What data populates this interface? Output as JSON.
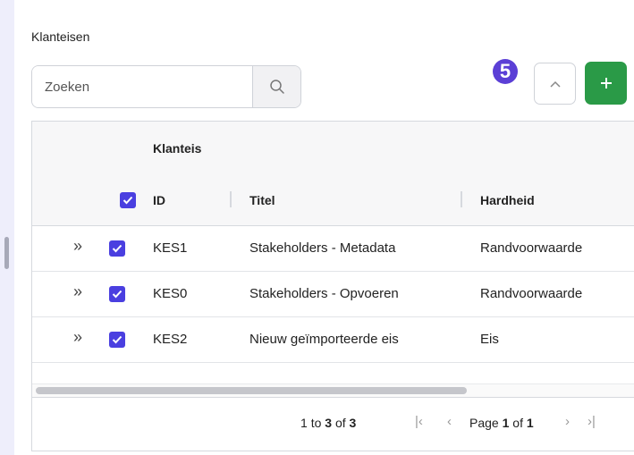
{
  "section": {
    "title": "Klanteisen"
  },
  "search": {
    "placeholder": "Zoeken"
  },
  "step_badge": "5",
  "colors": {
    "accent": "#5b3fd6",
    "add_button": "#2a9a47",
    "checkbox": "#4a3fe0"
  },
  "toolbar": {
    "collapse_icon": "chevron-up-icon",
    "add_icon": "plus-icon"
  },
  "table": {
    "group_header": "Klanteis",
    "headers": {
      "id": "ID",
      "title": "Titel",
      "hardness": "Hardheid"
    },
    "rows": [
      {
        "id": "KES1",
        "title": "Stakeholders - Metadata",
        "hardness": "Randvoorwaarde",
        "checked": true
      },
      {
        "id": "KES0",
        "title": "Stakeholders - Opvoeren",
        "hardness": "Randvoorwaarde",
        "checked": true
      },
      {
        "id": "KES2",
        "title": "Nieuw geïmporteerde eis",
        "hardness": "Eis",
        "checked": true
      }
    ]
  },
  "pagination": {
    "from": "1",
    "to_word": "to",
    "to": "3",
    "of_word": "of",
    "total": "3",
    "page_word": "Page",
    "page": "1",
    "page_of_word": "of",
    "page_total": "1"
  }
}
